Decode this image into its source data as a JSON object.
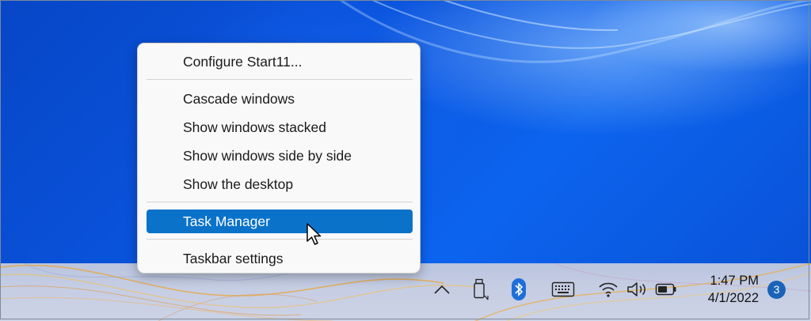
{
  "menu": {
    "items": [
      {
        "label": "Configure Start11..."
      },
      {
        "label": "Cascade windows"
      },
      {
        "label": "Show windows stacked"
      },
      {
        "label": "Show windows side by side"
      },
      {
        "label": "Show the desktop"
      },
      {
        "label": "Task Manager",
        "selected": true
      },
      {
        "label": "Taskbar settings"
      }
    ]
  },
  "tray": {
    "icons": [
      "chevron-up-icon",
      "usb-drive-icon",
      "bluetooth-icon",
      "keyboard-icon",
      "wifi-icon",
      "volume-icon",
      "battery-icon"
    ],
    "time": "1:47 PM",
    "date": "4/1/2022",
    "notification_count": "3"
  },
  "colors": {
    "menu_highlight": "#0a72c9",
    "desktop_blue": "#0a56e0",
    "bluetooth_blue": "#1e6fd9",
    "badge_blue": "#1b63b8"
  }
}
